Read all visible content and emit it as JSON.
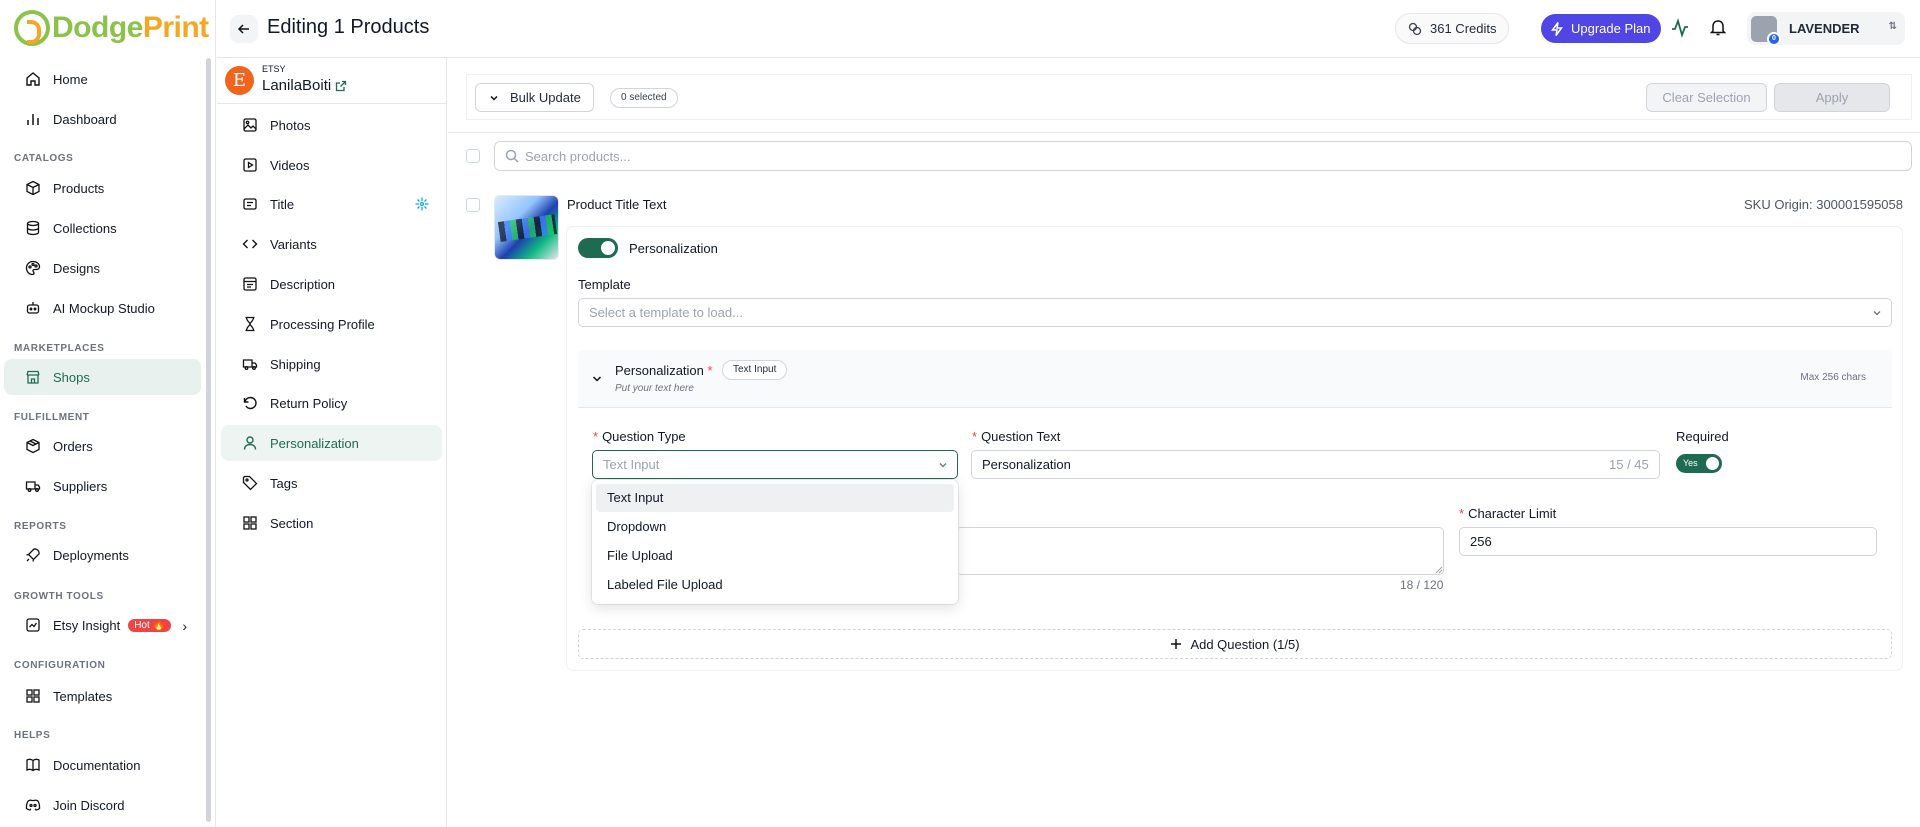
{
  "brand": {
    "name_part1": "Dodge",
    "name_part2": "Print"
  },
  "nav": {
    "home": "Home",
    "dashboard": "Dashboard",
    "group_catalogs": "CATALOGS",
    "products": "Products",
    "collections": "Collections",
    "designs": "Designs",
    "ai_mockup": "AI Mockup Studio",
    "group_marketplaces": "MARKETPLACES",
    "shops": "Shops",
    "group_fulfillment": "FULFILLMENT",
    "orders": "Orders",
    "suppliers": "Suppliers",
    "group_reports": "REPORTS",
    "deployments": "Deployments",
    "group_growth": "GROWTH TOOLS",
    "etsy_insight": "Etsy Insight",
    "hot_badge": "Hot 🔥",
    "group_configuration": "CONFIGURATION",
    "templates": "Templates",
    "group_helps": "HELPS",
    "documentation": "Documentation",
    "join_discord": "Join Discord"
  },
  "header": {
    "title": "Editing 1 Products",
    "credits": "361 Credits",
    "upgrade": "Upgrade Plan",
    "user_name": "LAVENDER",
    "avatar_badge": "0"
  },
  "shop": {
    "platform": "ETSY",
    "name": "LanilaBoiti"
  },
  "sections": {
    "photos": "Photos",
    "videos": "Videos",
    "title": "Title",
    "variants": "Variants",
    "description": "Description",
    "processing_profile": "Processing Profile",
    "shipping": "Shipping",
    "return_policy": "Return Policy",
    "personalization": "Personalization",
    "tags": "Tags",
    "section": "Section"
  },
  "bulk": {
    "bulk_update": "Bulk Update",
    "selected": "0 selected",
    "clear_selection": "Clear Selection",
    "apply": "Apply"
  },
  "search": {
    "placeholder": "Search products..."
  },
  "product": {
    "title": "Product Title Text",
    "sku": "SKU Origin: 300001595058"
  },
  "personalization": {
    "toggle_label": "Personalization",
    "enabled": true,
    "template_label": "Template",
    "template_placeholder": "Select a template to load...",
    "question_title": "Personalization",
    "question_required_mark": "*",
    "question_type_badge": "Text Input",
    "question_hint": "Put your text here",
    "max_chars": "Max 256 chars",
    "question_type_label": "Question Type",
    "question_type_value": "Text Input",
    "question_text_label": "Question Text",
    "question_text_value": "Personalization",
    "question_text_counter": "15 / 45",
    "required_label": "Required",
    "required_value": "Yes",
    "instructions_counter": "18 / 120",
    "char_limit_label": "Character Limit",
    "char_limit_value": "256",
    "add_question": "Add Question (1/5)"
  },
  "dropdown": {
    "options": [
      "Text Input",
      "Dropdown",
      "File Upload",
      "Labeled File Upload"
    ],
    "highlighted": "Text Input"
  },
  "colors": {
    "accent": "#1f6b52",
    "upgrade": "#4f46e5",
    "etsy": "#f1641e",
    "hot": "#ef4444"
  }
}
